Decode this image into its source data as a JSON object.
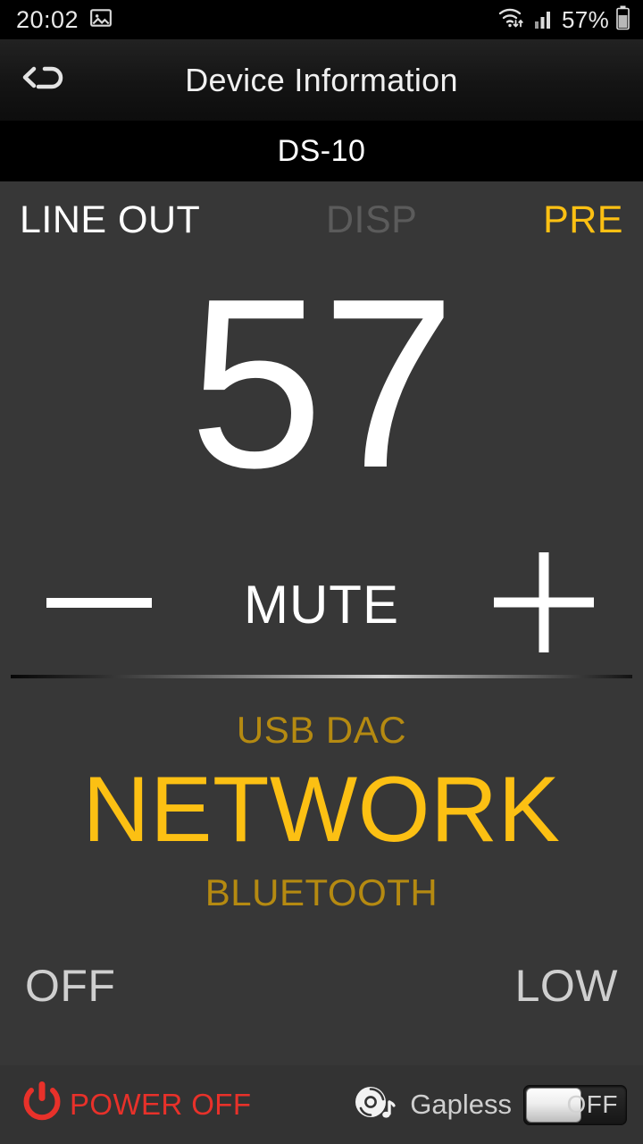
{
  "statusbar": {
    "clock": "20:02",
    "icons": {
      "gallery": "image-icon",
      "wifi": "wifi-transfer-icon",
      "signal": "cellular-signal-icon",
      "battery": "battery-icon"
    },
    "battery_percent": "57%"
  },
  "titlebar": {
    "back_icon": "back-arrow-icon",
    "title": "Device Information"
  },
  "device": {
    "name": "DS-10"
  },
  "mode_row": {
    "output": "LINE OUT",
    "display": "DISP",
    "preamp": "PRE"
  },
  "volume": {
    "value": "57",
    "minus_icon": "minus-icon",
    "mute_label": "MUTE",
    "plus_icon": "plus-icon"
  },
  "sources": {
    "previous": "USB DAC",
    "current": "NETWORK",
    "next": "BLUETOOTH"
  },
  "options": {
    "filter": "OFF",
    "gain": "LOW"
  },
  "bottombar": {
    "power_icon": "power-icon",
    "power_label": "POWER OFF",
    "gapless_icon": "vinyl-disc-music-icon",
    "gapless_label": "Gapless",
    "gapless_toggle_state": "OFF"
  },
  "colors": {
    "accent": "#fcc013",
    "accent_dim": "#b58a11",
    "danger": "#e8312a",
    "background": "#373737",
    "bar_background": "#000000"
  }
}
